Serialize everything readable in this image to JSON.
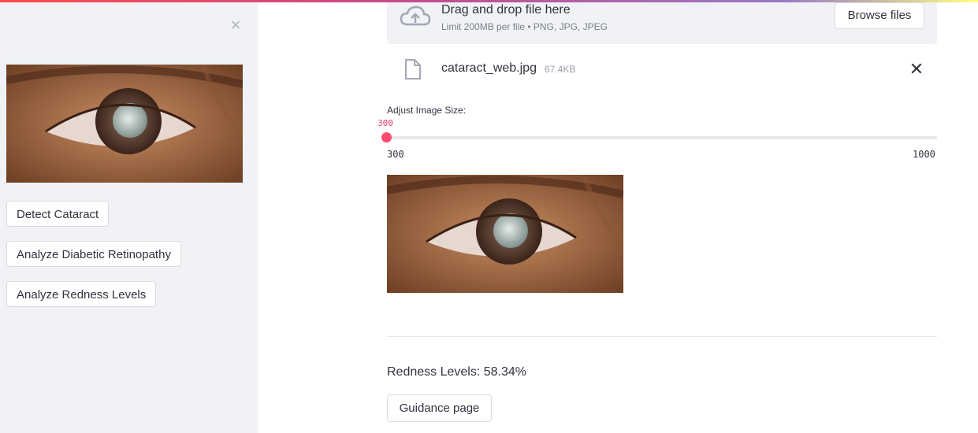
{
  "sidebar": {
    "close_glyph": "×",
    "buttons": [
      {
        "label": "Detect Cataract"
      },
      {
        "label": "Analyze Diabetic Retinopathy"
      },
      {
        "label": "Analyze Redness Levels"
      }
    ]
  },
  "uploader": {
    "title": "Drag and drop file here",
    "subtitle": "Limit 200MB per file • PNG, JPG, JPEG",
    "browse_label": "Browse files"
  },
  "file": {
    "name": "cataract_web.jpg",
    "size": "67.4KB",
    "remove_glyph": "✕"
  },
  "slider": {
    "label": "Adjust Image Size:",
    "value": "300",
    "min": "300",
    "max": "1000"
  },
  "result": {
    "redness_text": "Redness Levels: 58.34%"
  },
  "guidance_button": "Guidance page",
  "colors": {
    "accent": "#ff4b6e",
    "sidebar_bg": "#f0f2f6"
  }
}
